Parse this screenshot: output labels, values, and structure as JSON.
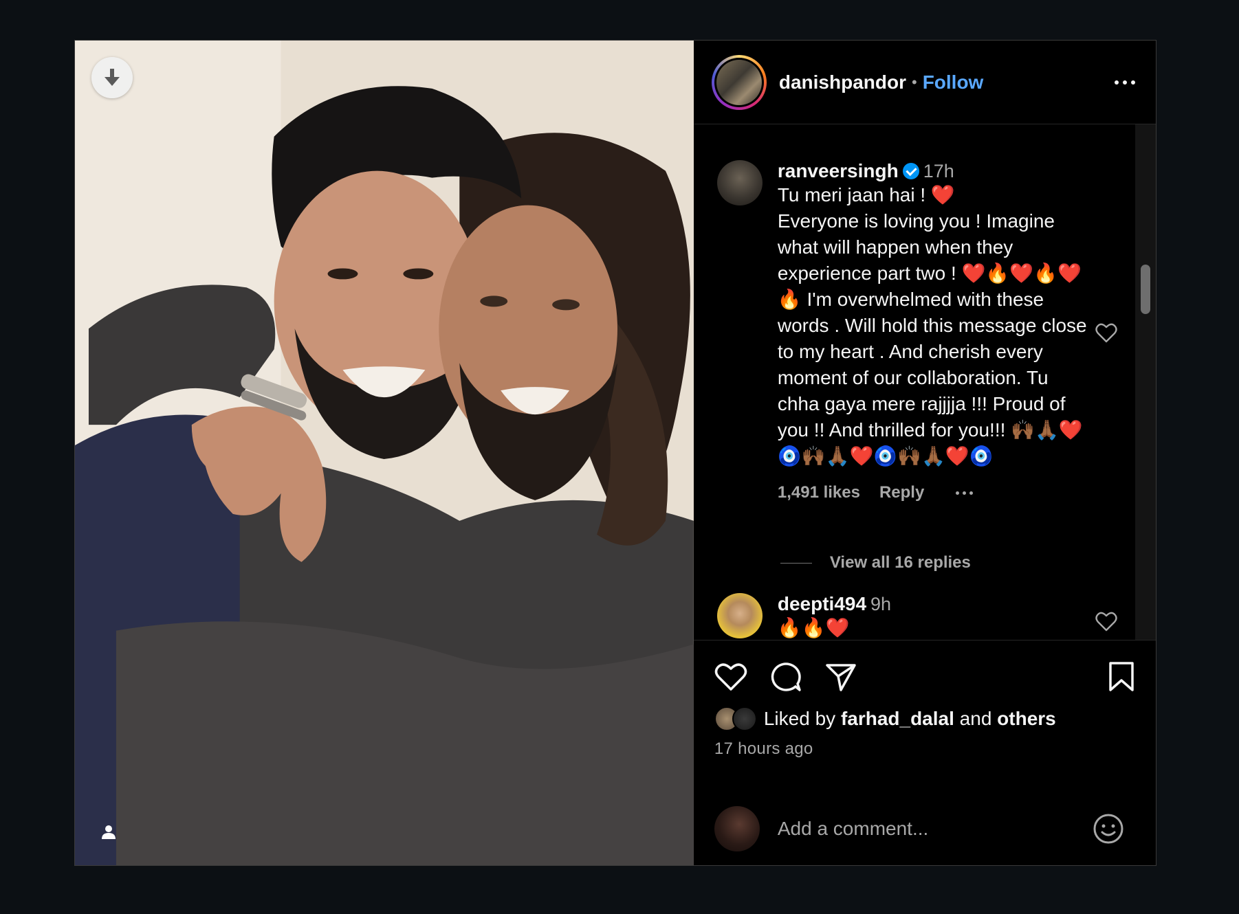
{
  "post": {
    "username": "danishpandor",
    "separator": "•",
    "follow_label": "Follow",
    "more_icon": "more-horizontal-icon"
  },
  "comments": [
    {
      "username": "ranveersingh",
      "verified": true,
      "time": "17h",
      "text": "Tu meri jaan hai ! ❤️\nEveryone is loving you ! Imagine what will happen when they experience part two ! ❤️🔥❤️🔥❤️🔥 I'm overwhelmed with these words . Will hold this message close to my heart . And cherish every moment of our collaboration. Tu chha gaya mere rajjjja !!! Proud of you !! And thrilled for you!!! 🙌🏾🙏🏾❤️🧿🙌🏾🙏🏾❤️🧿🙌🏾🙏🏾❤️🧿",
      "likes": "1,491 likes",
      "reply_label": "Reply",
      "view_replies": "View all 16 replies"
    },
    {
      "username": "deepti494",
      "verified": false,
      "time": "9h",
      "text": "🔥🔥❤️"
    }
  ],
  "actions": {
    "liked_prefix": "Liked by",
    "liked_user": "farhad_dalal",
    "liked_and": "and",
    "liked_others": "others",
    "time_ago": "17 hours ago"
  },
  "composer": {
    "placeholder": "Add a comment..."
  },
  "colors": {
    "background": "#0c1014",
    "link": "#5aa8ff",
    "verified": "#0095f6",
    "muted_text": "#a8a8a8"
  }
}
